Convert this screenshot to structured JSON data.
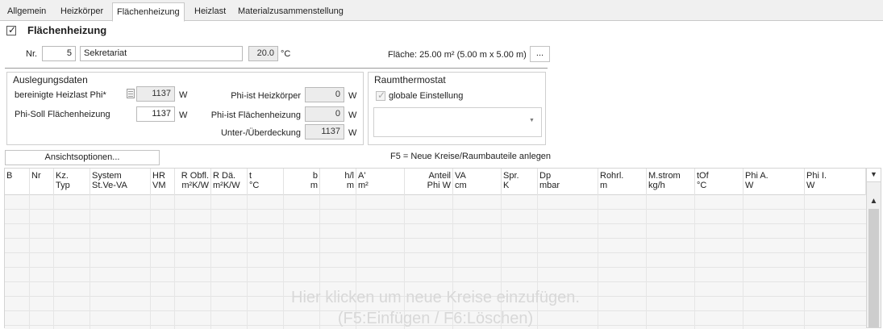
{
  "tabs": [
    {
      "label": "Allgemein",
      "active": false
    },
    {
      "label": "Heizkörper",
      "active": false
    },
    {
      "label": "Flächenheizung",
      "active": true
    },
    {
      "label": "Heizlast",
      "active": false
    },
    {
      "label": "Materialzusammenstellung",
      "active": false
    }
  ],
  "section": {
    "title": "Flächenheizung",
    "checked": true
  },
  "room": {
    "nr_label": "Nr.",
    "nr_value": "5",
    "name": "Sekretariat",
    "temperature": "20.0",
    "temperature_unit": "°C",
    "area_text": "Fläche: 25.00  m² (5.00 m x 5.00 m)",
    "more_button": "..."
  },
  "auslegung": {
    "title": "Auslegungsdaten",
    "heizlast_label": "bereinigte Heizlast Phi*",
    "heizlast_value": "1137",
    "phi_soll_label": "Phi-Soll Flächenheizung",
    "phi_soll_value": "1137",
    "phi_ist_hk_label": "Phi-ist Heizkörper",
    "phi_ist_hk_value": "0",
    "phi_ist_fh_label": "Phi-ist Flächenheizung",
    "phi_ist_fh_value": "0",
    "deckung_label": "Unter-/Überdeckung",
    "deckung_value": "1137",
    "unit": "W"
  },
  "thermostat": {
    "title": "Raumthermostat",
    "global_label": "globale Einstellung",
    "global_checked": true,
    "dropdown_value": ""
  },
  "view_options_button": "Ansichtsoptionen...",
  "hint": "F5 = Neue Kreise/Raumbauteile anlegen",
  "grid": {
    "columns": [
      {
        "l1": "B",
        "l2": ""
      },
      {
        "l1": "Nr",
        "l2": ""
      },
      {
        "l1": "Kz.",
        "l2": "Typ"
      },
      {
        "l1": "System",
        "l2": "St.Ve-VA"
      },
      {
        "l1": "HR",
        "l2": "VM"
      },
      {
        "l1": "R Obfl.",
        "l2": "m²K/W"
      },
      {
        "l1": "R Dä.",
        "l2": "m²K/W"
      },
      {
        "l1": "t",
        "l2": "°C"
      },
      {
        "l1": "b",
        "l2": "m"
      },
      {
        "l1": "h/l",
        "l2": "m"
      },
      {
        "l1": "A'",
        "l2": "m²"
      },
      {
        "l1": "Anteil",
        "l2": "Phi W"
      },
      {
        "l1": "VA",
        "l2": "cm"
      },
      {
        "l1": "Spr.",
        "l2": "K"
      },
      {
        "l1": "Dp",
        "l2": "mbar"
      },
      {
        "l1": "Rohrl.",
        "l2": "m"
      },
      {
        "l1": "M.strom",
        "l2": "kg/h"
      },
      {
        "l1": "tOf",
        "l2": "°C"
      },
      {
        "l1": "Phi A.",
        "l2": "W"
      },
      {
        "l1": "Phi I.",
        "l2": "W"
      }
    ],
    "placeholder_line1": "Hier klicken um neue Kreise einzufügen.",
    "placeholder_line2": "(F5:Einfügen / F6:Löschen)"
  }
}
